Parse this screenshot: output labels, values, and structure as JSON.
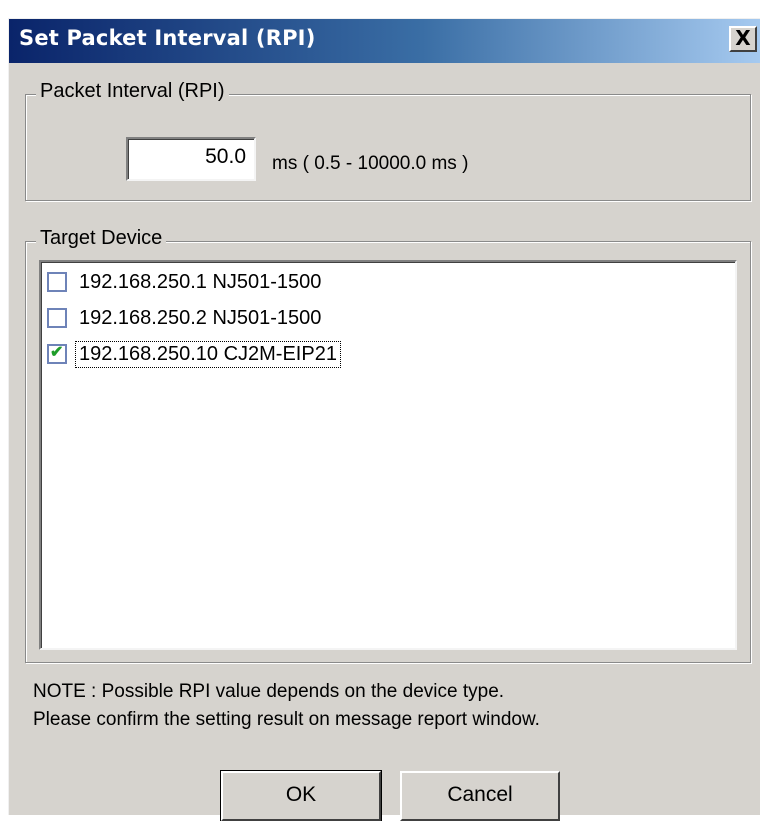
{
  "window": {
    "title": "Set Packet Interval (RPI)",
    "close_glyph": "X"
  },
  "rpi_group": {
    "legend": "Packet Interval (RPI)",
    "value": "50.0",
    "unit_range": "ms ( 0.5 - 10000.0 ms )"
  },
  "target_group": {
    "legend": "Target Device",
    "items": [
      {
        "label": "192.168.250.1 NJ501-1500",
        "checked": false,
        "focused": false
      },
      {
        "label": "192.168.250.2 NJ501-1500",
        "checked": false,
        "focused": false
      },
      {
        "label": "192.168.250.10 CJ2M-EIP21",
        "checked": true,
        "focused": true
      }
    ],
    "check_glyph": "✔"
  },
  "note": {
    "line1": "NOTE : Possible RPI value depends on the device type.",
    "line2": "Please confirm the setting result on message report window."
  },
  "buttons": {
    "ok_label": "OK",
    "cancel_label": "Cancel"
  },
  "colors": {
    "title_gradient_start": "#0a246a",
    "title_gradient_end": "#a6caf0",
    "dialog_face": "#d6d3ce",
    "check_color": "#1f9d2a"
  }
}
